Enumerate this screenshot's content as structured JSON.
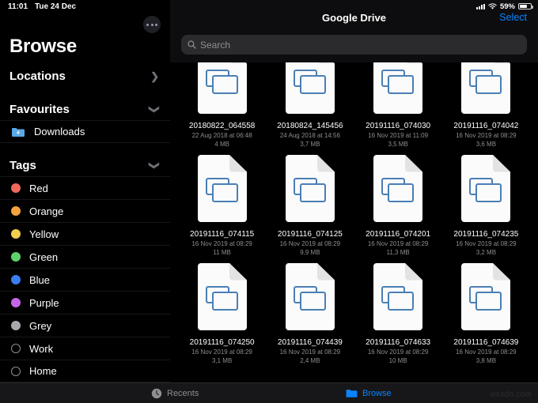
{
  "status_bar": {
    "time": "11:01",
    "date": "Tue 24 Dec",
    "battery_percent": "59%",
    "signal_icon": "cellular-signal-icon",
    "wifi_icon": "wifi-icon",
    "battery_icon": "battery-icon"
  },
  "sidebar": {
    "title": "Browse",
    "more_button": "more-options-button",
    "sections": [
      {
        "label": "Locations",
        "chevron": "chevron-right-icon",
        "items": []
      },
      {
        "label": "Favourites",
        "chevron": "chevron-down-icon",
        "items": [
          {
            "label": "Downloads",
            "icon": "downloads-folder-icon"
          }
        ]
      },
      {
        "label": "Tags",
        "chevron": "chevron-down-icon",
        "items": [
          {
            "label": "Red",
            "color": "#f0685c",
            "filled": true
          },
          {
            "label": "Orange",
            "color": "#f5a33c",
            "filled": true
          },
          {
            "label": "Yellow",
            "color": "#f2ce4b",
            "filled": true
          },
          {
            "label": "Green",
            "color": "#5ed16b",
            "filled": true
          },
          {
            "label": "Blue",
            "color": "#3b7ef0",
            "filled": true
          },
          {
            "label": "Purple",
            "color": "#c濃",
            "filled": true
          },
          {
            "label": "Grey",
            "color": "#a8a8ad",
            "filled": true
          },
          {
            "label": "Work",
            "color": "#8e8e93",
            "filled": false
          },
          {
            "label": "Home",
            "color": "#8e8e93",
            "filled": false
          }
        ]
      }
    ]
  },
  "main": {
    "nav_title": "Google Drive",
    "select_label": "Select",
    "search": {
      "placeholder": "Search",
      "value": "",
      "icon": "search-icon"
    },
    "files": [
      {
        "name": "20180822_064558",
        "date": "22 Aug 2018 at 06:48",
        "size": "4 MB",
        "icon": "presentation-file-icon"
      },
      {
        "name": "20180824_145456",
        "date": "24 Aug 2018 at 14:56",
        "size": "3,7 MB",
        "icon": "presentation-file-icon"
      },
      {
        "name": "20191116_074030",
        "date": "16 Nov 2019 at 11:09",
        "size": "3,5 MB",
        "icon": "presentation-file-icon"
      },
      {
        "name": "20191116_074042",
        "date": "16 Nov 2019 at 08:29",
        "size": "3,6 MB",
        "icon": "presentation-file-icon"
      },
      {
        "name": "20191116_074115",
        "date": "16 Nov 2019 at 08:29",
        "size": "11 MB",
        "icon": "presentation-file-icon"
      },
      {
        "name": "20191116_074125",
        "date": "16 Nov 2019 at 08:29",
        "size": "9,9 MB",
        "icon": "presentation-file-icon"
      },
      {
        "name": "20191116_074201",
        "date": "16 Nov 2019 at 08:29",
        "size": "11,3 MB",
        "icon": "presentation-file-icon"
      },
      {
        "name": "20191116_074235",
        "date": "16 Nov 2019 at 08:29",
        "size": "3,2 MB",
        "icon": "presentation-file-icon"
      },
      {
        "name": "20191116_074250",
        "date": "16 Nov 2019 at 08:29",
        "size": "3,1 MB",
        "icon": "presentation-file-icon"
      },
      {
        "name": "20191116_074439",
        "date": "16 Nov 2019 at 08:29",
        "size": "2,4 MB",
        "icon": "presentation-file-icon"
      },
      {
        "name": "20191116_074633",
        "date": "16 Nov 2019 at 08:29",
        "size": "10 MB",
        "icon": "presentation-file-icon"
      },
      {
        "name": "20191116_074639",
        "date": "16 Nov 2019 at 08:29",
        "size": "3,8 MB",
        "icon": "presentation-file-icon"
      }
    ]
  },
  "tab_bar": {
    "tabs": [
      {
        "label": "Recents",
        "icon": "clock-icon",
        "active": false
      },
      {
        "label": "Browse",
        "icon": "folder-icon",
        "active": true
      }
    ]
  },
  "watermark": "wsxdn.com",
  "colors": {
    "accent": "#0a84ff",
    "background": "#000000",
    "panel": "#0d0d0f",
    "muted": "#8e8e93"
  }
}
